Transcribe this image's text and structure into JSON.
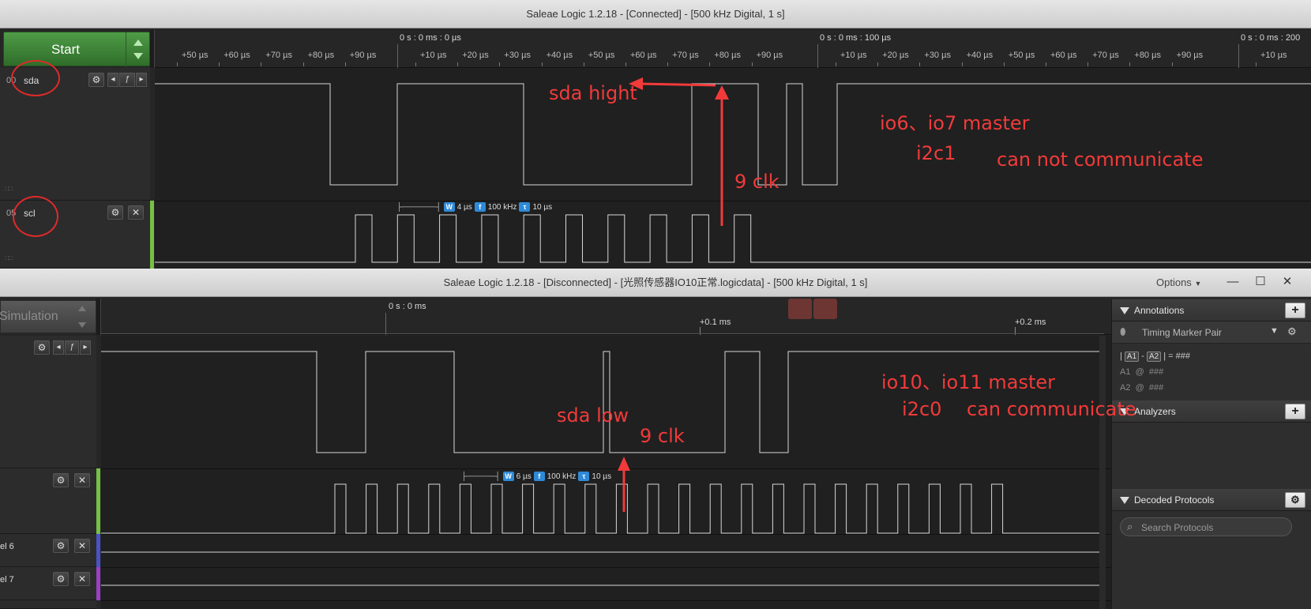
{
  "win1": {
    "title": "Saleae Logic 1.2.18 - [Connected] - [500 kHz Digital, 1 s]",
    "start_label": "Start",
    "major_ticks": [
      "0 s : 0 ms : 0 µs",
      "0 s : 0 ms : 100 µs",
      "0 s : 0 ms : 200"
    ],
    "minor_ticks_a": [
      "+50 µs",
      "+60 µs",
      "+70 µs",
      "+80 µs",
      "+90 µs"
    ],
    "minor_ticks_b": [
      "+10 µs",
      "+20 µs",
      "+30 µs",
      "+40 µs",
      "+50 µs",
      "+60 µs",
      "+70 µs",
      "+80 µs",
      "+90 µs"
    ],
    "minor_ticks_c": [
      "+10 µs",
      "+20 µs",
      "+30 µs",
      "+40 µs",
      "+50 µs",
      "+60 µs",
      "+70 µs",
      "+80 µs",
      "+90 µs"
    ],
    "minor_ticks_d": [
      "+10 µs"
    ],
    "channels": [
      {
        "num": "00",
        "name": "sda"
      },
      {
        "num": "05",
        "name": "scl"
      }
    ],
    "measure": {
      "width": "4 µs",
      "freq": "100 kHz",
      "period": "10 µs"
    },
    "badges": {
      "w": "W",
      "f": "f",
      "t": "τ"
    },
    "annotations": {
      "sda_hight": "sda hight",
      "nine_clk": "9 clk",
      "master": "io6、io7 master",
      "bus": "i2c1",
      "status": "can not communicate"
    }
  },
  "win2": {
    "title": "Saleae Logic 1.2.18 - [Disconnected] - [光照传感器IO10正常.logicdata] - [500 kHz Digital, 1 s]",
    "options_label": "Options",
    "sim_label": "Simulation",
    "major_ticks": [
      "0 s : 0 ms",
      "+0.1 ms",
      "+0.2 ms"
    ],
    "channels": [
      {
        "name": ""
      },
      {
        "name": ""
      },
      {
        "name": "el 6"
      },
      {
        "name": "el 7"
      }
    ],
    "measure": {
      "width": "6 µs",
      "freq": "100 kHz",
      "period": "10 µs"
    },
    "annotations": {
      "sda_low": "sda low",
      "nine_clk": "9 clk",
      "master": "io10、io11 master",
      "bus": "i2c0",
      "status": "can communicate"
    },
    "side_panel": {
      "annotations_title": "Annotations",
      "timing_marker": "Timing Marker Pair",
      "marker_line": {
        "a1": "A1",
        "a2": "A2",
        "value": "###"
      },
      "a1_row": {
        "label": "A1",
        "at": "@",
        "value": "###"
      },
      "a2_row": {
        "label": "A2",
        "at": "@",
        "value": "###"
      },
      "analyzers_title": "Analyzers",
      "decoded_title": "Decoded Protocols",
      "search_placeholder": "Search Protocols"
    }
  },
  "colors": {
    "annotation_red": "#f23a3a",
    "start_green": "#3e8a37",
    "scl_bar": "#76c043",
    "ch6_bar": "#4a52c8",
    "ch7_bar": "#9b3fc4",
    "badge_blue": "#2e8ad8"
  },
  "icons": [
    "gear-icon",
    "trigger-icon",
    "left-arrow-icon",
    "right-arrow-icon",
    "close-icon",
    "plus-icon",
    "search-icon",
    "pin-icon",
    "minimize-icon",
    "maximize-icon",
    "triangle-down-icon"
  ]
}
